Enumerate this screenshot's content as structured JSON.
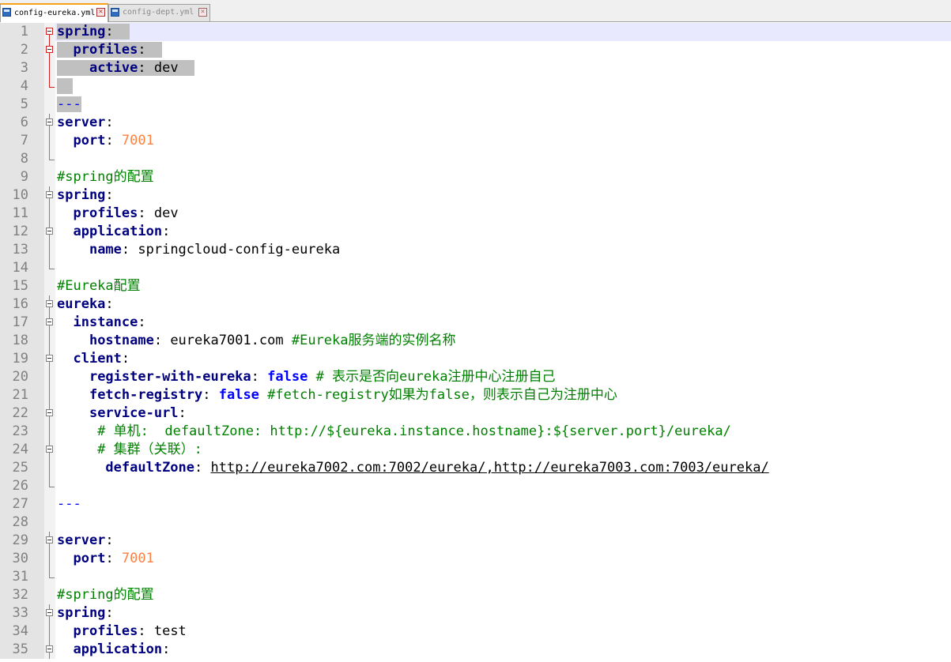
{
  "tabs": [
    {
      "label": "config-eureka.yml",
      "active": true
    },
    {
      "label": "config-dept.yml",
      "active": false
    }
  ],
  "editor": {
    "selection_color": "#c0c0c0",
    "lines": [
      {
        "num": "1",
        "fold": "box-red",
        "parts": [
          {
            "t": "spring",
            "c": "k",
            "sel": true
          },
          {
            "t": ":  ",
            "c": "v",
            "sel": true
          }
        ]
      },
      {
        "num": "2",
        "fold": "box-red",
        "parts": [
          {
            "t": "  ",
            "c": "v",
            "sel": true
          },
          {
            "t": "profiles",
            "c": "k",
            "sel": true
          },
          {
            "t": ":  ",
            "c": "v",
            "sel": true
          }
        ]
      },
      {
        "num": "3",
        "fold": "vline-red",
        "parts": [
          {
            "t": "    ",
            "c": "v",
            "sel": true
          },
          {
            "t": "active",
            "c": "k",
            "sel": true
          },
          {
            "t": ": dev  ",
            "c": "v",
            "sel": true
          }
        ]
      },
      {
        "num": "4",
        "fold": "end-red",
        "parts": [
          {
            "t": "  ",
            "c": "v",
            "sel": true
          }
        ]
      },
      {
        "num": "5",
        "fold": "",
        "parts": [
          {
            "t": "---",
            "c": "dash",
            "sel": true
          }
        ]
      },
      {
        "num": "6",
        "fold": "box",
        "parts": [
          {
            "t": "server",
            "c": "k"
          },
          {
            "t": ":",
            "c": "v"
          }
        ]
      },
      {
        "num": "7",
        "fold": "vline",
        "parts": [
          {
            "t": "  ",
            "c": "v"
          },
          {
            "t": "port",
            "c": "k"
          },
          {
            "t": ": ",
            "c": "v"
          },
          {
            "t": "7001",
            "c": "n"
          }
        ]
      },
      {
        "num": "8",
        "fold": "end",
        "parts": []
      },
      {
        "num": "9",
        "fold": "",
        "parts": [
          {
            "t": "#spring的配置",
            "c": "c"
          }
        ]
      },
      {
        "num": "10",
        "fold": "box",
        "parts": [
          {
            "t": "spring",
            "c": "k"
          },
          {
            "t": ":",
            "c": "v"
          }
        ]
      },
      {
        "num": "11",
        "fold": "vline",
        "parts": [
          {
            "t": "  ",
            "c": "v"
          },
          {
            "t": "profiles",
            "c": "k"
          },
          {
            "t": ": dev",
            "c": "v"
          }
        ]
      },
      {
        "num": "12",
        "fold": "box",
        "parts": [
          {
            "t": "  ",
            "c": "v"
          },
          {
            "t": "application",
            "c": "k"
          },
          {
            "t": ":",
            "c": "v"
          }
        ]
      },
      {
        "num": "13",
        "fold": "vline",
        "parts": [
          {
            "t": "    ",
            "c": "v"
          },
          {
            "t": "name",
            "c": "k"
          },
          {
            "t": ": springcloud-config-eureka",
            "c": "v"
          }
        ]
      },
      {
        "num": "14",
        "fold": "end",
        "parts": []
      },
      {
        "num": "15",
        "fold": "",
        "parts": [
          {
            "t": "#Eureka配置",
            "c": "c"
          }
        ]
      },
      {
        "num": "16",
        "fold": "box",
        "parts": [
          {
            "t": "eureka",
            "c": "k"
          },
          {
            "t": ":",
            "c": "v"
          }
        ]
      },
      {
        "num": "17",
        "fold": "box",
        "parts": [
          {
            "t": "  ",
            "c": "v"
          },
          {
            "t": "instance",
            "c": "k"
          },
          {
            "t": ":",
            "c": "v"
          }
        ]
      },
      {
        "num": "18",
        "fold": "vline",
        "parts": [
          {
            "t": "    ",
            "c": "v"
          },
          {
            "t": "hostname",
            "c": "k"
          },
          {
            "t": ": eureka7001.com ",
            "c": "v"
          },
          {
            "t": "#Eureka服务端的实例名称",
            "c": "c"
          }
        ]
      },
      {
        "num": "19",
        "fold": "box",
        "parts": [
          {
            "t": "  ",
            "c": "v"
          },
          {
            "t": "client",
            "c": "k"
          },
          {
            "t": ":",
            "c": "v"
          }
        ]
      },
      {
        "num": "20",
        "fold": "vline",
        "parts": [
          {
            "t": "    ",
            "c": "v"
          },
          {
            "t": "register-with-eureka",
            "c": "k"
          },
          {
            "t": ": ",
            "c": "v"
          },
          {
            "t": "false",
            "c": "b"
          },
          {
            "t": " # 表示是否向eureka注册中心注册自己",
            "c": "c"
          }
        ]
      },
      {
        "num": "21",
        "fold": "vline",
        "parts": [
          {
            "t": "    ",
            "c": "v"
          },
          {
            "t": "fetch-registry",
            "c": "k"
          },
          {
            "t": ": ",
            "c": "v"
          },
          {
            "t": "false",
            "c": "b"
          },
          {
            "t": " #fetch-registry如果为false，则表示自己为注册中心",
            "c": "c"
          }
        ]
      },
      {
        "num": "22",
        "fold": "box",
        "parts": [
          {
            "t": "    ",
            "c": "v"
          },
          {
            "t": "service-url",
            "c": "k"
          },
          {
            "t": ":",
            "c": "v"
          }
        ]
      },
      {
        "num": "23",
        "fold": "vline",
        "parts": [
          {
            "t": "     # 单机:  defaultZone: http://${eureka.instance.hostname}:${server.port}/eureka/",
            "c": "c"
          }
        ]
      },
      {
        "num": "24",
        "fold": "box",
        "parts": [
          {
            "t": "     # 集群（关联）:",
            "c": "c"
          }
        ]
      },
      {
        "num": "25",
        "fold": "vline",
        "parts": [
          {
            "t": "      ",
            "c": "v"
          },
          {
            "t": "defaultZone",
            "c": "k"
          },
          {
            "t": ": ",
            "c": "v"
          },
          {
            "t": "http://eureka7002.com:7002/eureka/,http://eureka7003.com:7003/eureka/",
            "c": "u"
          }
        ]
      },
      {
        "num": "26",
        "fold": "end",
        "parts": []
      },
      {
        "num": "27",
        "fold": "",
        "parts": [
          {
            "t": "---",
            "c": "dash"
          }
        ]
      },
      {
        "num": "28",
        "fold": "",
        "parts": []
      },
      {
        "num": "29",
        "fold": "box",
        "parts": [
          {
            "t": "server",
            "c": "k"
          },
          {
            "t": ":",
            "c": "v"
          }
        ]
      },
      {
        "num": "30",
        "fold": "vline",
        "parts": [
          {
            "t": "  ",
            "c": "v"
          },
          {
            "t": "port",
            "c": "k"
          },
          {
            "t": ": ",
            "c": "v"
          },
          {
            "t": "7001",
            "c": "n"
          }
        ]
      },
      {
        "num": "31",
        "fold": "end",
        "parts": []
      },
      {
        "num": "32",
        "fold": "",
        "parts": [
          {
            "t": "#spring的配置",
            "c": "c"
          }
        ]
      },
      {
        "num": "33",
        "fold": "box",
        "parts": [
          {
            "t": "spring",
            "c": "k"
          },
          {
            "t": ":",
            "c": "v"
          }
        ]
      },
      {
        "num": "34",
        "fold": "vline",
        "parts": [
          {
            "t": "  ",
            "c": "v"
          },
          {
            "t": "profiles",
            "c": "k"
          },
          {
            "t": ": test",
            "c": "v"
          }
        ]
      },
      {
        "num": "35",
        "fold": "box",
        "parts": [
          {
            "t": "  ",
            "c": "v"
          },
          {
            "t": "application",
            "c": "k"
          },
          {
            "t": ":",
            "c": "v"
          }
        ]
      }
    ]
  }
}
